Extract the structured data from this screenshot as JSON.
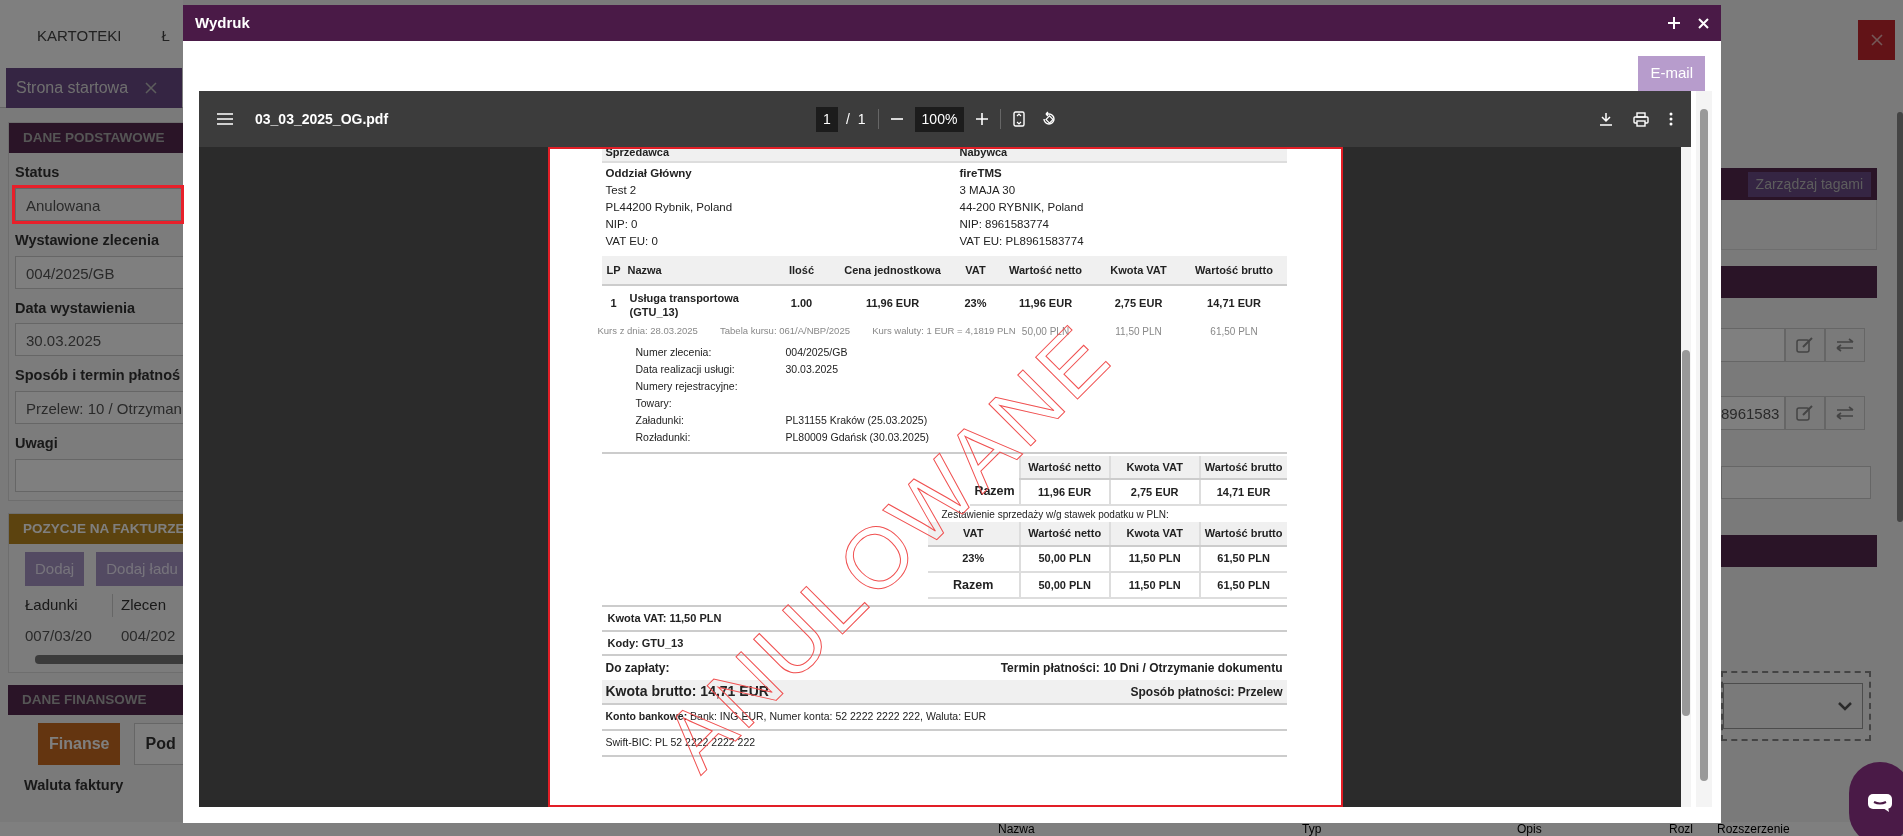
{
  "app": {
    "nav": [
      "KARTOTEKI",
      "Ł"
    ],
    "open_tab": "Strona startowa",
    "basic": {
      "title": "DANE PODSTAWOWE",
      "fields": [
        {
          "label": "Status",
          "value": "Anulowana",
          "highlighted": true
        },
        {
          "label": "Wystawione zlecenia",
          "value": "004/2025/GB",
          "highlighted": false
        },
        {
          "label": "Data wystawienia",
          "value": "30.03.2025",
          "highlighted": false
        },
        {
          "label": "Sposób i termin płatnoś",
          "value": "Przelew: 10 / Otrzyman",
          "highlighted": false
        },
        {
          "label": "Uwagi",
          "highlighted": false
        }
      ]
    },
    "items": {
      "title": "POZYCJE NA FAKTURZE",
      "buttons": [
        "Dodaj",
        "Dodaj ładu"
      ],
      "columns": [
        "Ładunki",
        "Zlecen"
      ],
      "row": [
        "007/03/20",
        "004/202"
      ]
    },
    "finance": {
      "title": "DANE FINANSOWE",
      "tabs": [
        {
          "label": "Finanse",
          "selected": true
        },
        {
          "label": "Pod",
          "selected": false
        }
      ],
      "field_label": "Waluta faktury"
    },
    "right": {
      "tags_button": "Zarządzaj tagami",
      "nip_fragment": "8961583"
    },
    "bottom_columns": [
      "Nazwa",
      "Typ",
      "Opis",
      "Rozl",
      "Rozszerzenie"
    ]
  },
  "dialog": {
    "title": "Wydruk",
    "email_button": "E-mail",
    "viewer": {
      "filename": "03_03_2025_OG.pdf",
      "page": "1",
      "page_separator": "/",
      "pages": "1",
      "zoom": "100%",
      "page_highlighted": true
    },
    "document": {
      "seller": {
        "heading": "Sprzedawca",
        "lines": [
          "Oddział Główny",
          "Test 2",
          "PL44200 Rybnik, Poland",
          "NIP: 0",
          "VAT EU: 0"
        ]
      },
      "buyer": {
        "heading": "Nabywca",
        "lines": [
          "fireTMS",
          "3 MAJA 30",
          "44-200 RYBNIK, Poland",
          "NIP: 8961583774",
          "VAT EU: PL8961583774"
        ]
      },
      "items_columns": [
        "LP",
        "Nazwa",
        "Ilość",
        "Cena jednostkowa",
        "VAT",
        "Wartość netto",
        "Kwota VAT",
        "Wartość brutto"
      ],
      "item": {
        "cells": [
          "1",
          "Usługa transportowa (GTU_13)",
          "1.00",
          "11,96 EUR",
          "23%",
          "11,96 EUR",
          "2,75 EUR",
          "14,71 EUR"
        ],
        "rate_info": [
          "Kurs z dnia: 28.03.2025",
          "Tabela kursu: 061/A/NBP/2025",
          "Kurs waluty: 1 EUR = 4,1819 PLN"
        ],
        "pln_values": [
          "50,00 PLN",
          "11,50 PLN",
          "61,50 PLN"
        ],
        "details": [
          {
            "label": "Numer zlecenia:",
            "value": "004/2025/GB"
          },
          {
            "label": "Data realizacji usługi:",
            "value": "30.03.2025"
          },
          {
            "label": "Numery rejestracyjne:"
          },
          {
            "label": "Towary:"
          },
          {
            "label": "Załadunki:",
            "value": "PL31155 Kraków (25.03.2025)"
          },
          {
            "label": "Rozładunki:",
            "value": "PL80009 Gdańsk (30.03.2025)"
          }
        ]
      },
      "totals": {
        "columns": [
          "Wartość netto",
          "Kwota VAT",
          "Wartość brutto"
        ],
        "row": [
          "Razem",
          "11,96 EUR",
          "2,75 EUR",
          "14,71 EUR"
        ]
      },
      "pln_summary": {
        "caption": "Zestawienie sprzedaży w/g stawek podatku w PLN:",
        "columns": [
          "VAT",
          "Wartość netto",
          "Kwota VAT",
          "Wartość brutto"
        ],
        "rows": [
          [
            "23%",
            "50,00 PLN",
            "11,50 PLN",
            "61,50 PLN"
          ],
          [
            "Razem",
            "50,00 PLN",
            "11,50 PLN",
            "61,50 PLN"
          ]
        ]
      },
      "vat_amount": "Kwota VAT: 11,50 PLN",
      "codes": "Kody: GTU_13",
      "to_pay": "Do zapłaty:",
      "payment_term": "Termin płatności: 10 Dni / Otrzymanie dokumentu",
      "gross": "Kwota brutto: 14,71 EUR",
      "payment_method": "Sposób płatności: Przelew",
      "bank": "**Konto bankowe:** Bank: ING EUR, Numer konta: 52 2222 2222 222, Waluta: EUR",
      "swift": "Swift-BIC: PL 52 2222 2222 222",
      "watermark": "ANULOWANE"
    }
  }
}
